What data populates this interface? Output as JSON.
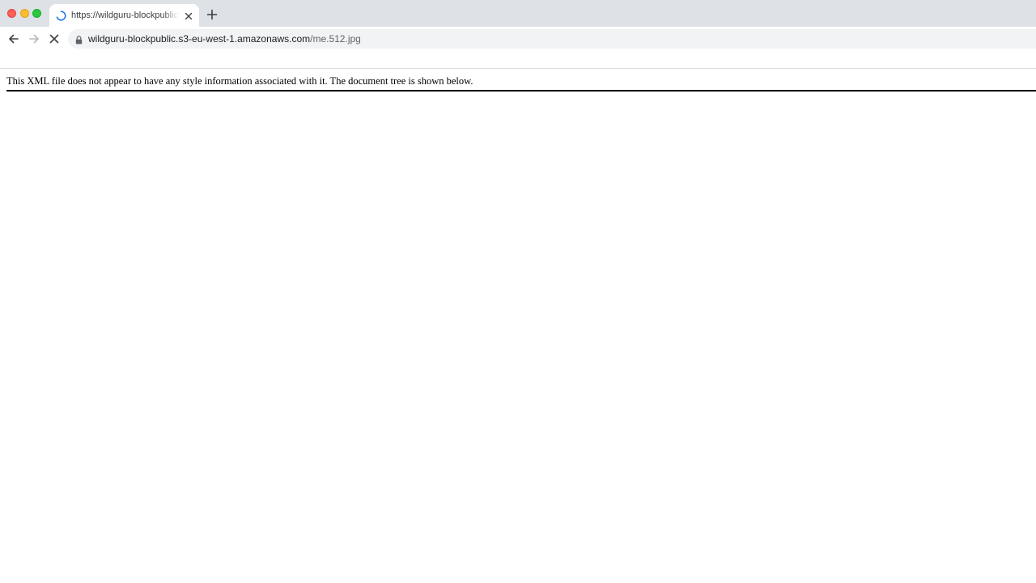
{
  "window": {
    "controls": [
      "close",
      "minimize",
      "maximize"
    ]
  },
  "tab": {
    "title": "https://wildguru-blockpublic.s3-eu-west-1.amazonaws.com/me.512.jpg",
    "loading": true,
    "spinner_icon": "loading-spinner-icon",
    "close_icon": "close-icon"
  },
  "new_tab": {
    "icon": "plus-icon"
  },
  "toolbar": {
    "back_icon": "arrow-left-icon",
    "forward_icon": "arrow-right-icon",
    "stop_icon": "close-icon",
    "lock_icon": "lock-icon"
  },
  "address": {
    "host": "wildguru-blockpublic.s3-eu-west-1.amazonaws.com",
    "path": "/me.512.jpg"
  },
  "page": {
    "message": "This XML file does not appear to have any style information associated with it. The document tree is shown below."
  },
  "colors": {
    "tabstrip": "#dee1e6",
    "omnibox": "#f1f3f4",
    "spinner": "#1a73e8",
    "close_light": "#ff5f57",
    "minimize_light": "#febc2e",
    "maximize_light": "#28c840"
  }
}
